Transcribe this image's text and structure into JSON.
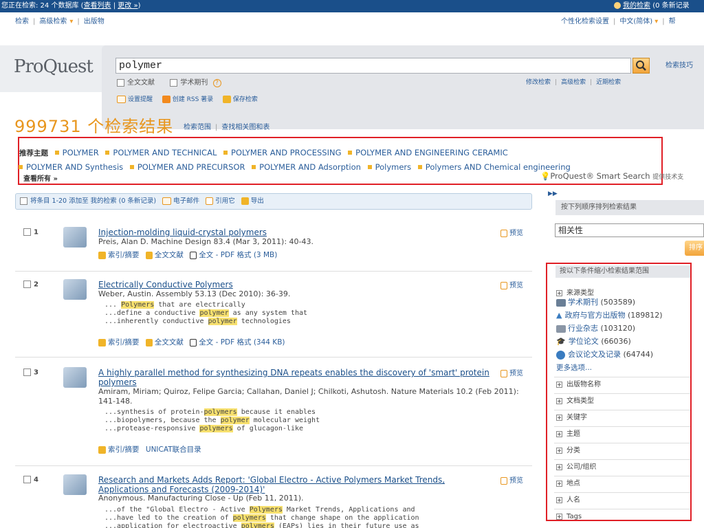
{
  "topbar": {
    "status_prefix": "您正在检索: 24 个数据库 (",
    "view_list": "查看列表",
    "sep": " | ",
    "change": "更改 »",
    "status_suffix": ")",
    "my_search": "我的检索",
    "my_search_suffix": "(0 条新记录"
  },
  "topnav": {
    "items": [
      "检索",
      "高级检索",
      "出版物"
    ],
    "right": [
      "个性化检索设置",
      "中文(简体)",
      "帮"
    ]
  },
  "logo": "ProQuest",
  "search": {
    "query": "polymer",
    "tips": "检索技巧",
    "opt_fulltext": "全文文献",
    "opt_scholarly": "学术期刊",
    "mod_links": [
      "修改检索",
      "高级检索",
      "近期检索"
    ],
    "actions": [
      "设置提醒",
      "创建 RSS 著录",
      "保存检索"
    ]
  },
  "results_header": {
    "count": "999731",
    "count_label": "个检索结果",
    "scope": "检索范围",
    "find_tables": "查找相关图和表"
  },
  "recommended": {
    "label": "推荐主题",
    "row1": [
      "POLYMER",
      "POLYMER AND TECHNICAL",
      "POLYMER AND PROCESSING",
      "POLYMER AND ENGINEERING CERAMIC"
    ],
    "row2": [
      "POLYMER AND Synthesis",
      "POLYMER AND PRECURSOR",
      "POLYMER AND Adsorption",
      "Polymers",
      "Polymers AND Chemical engineering"
    ],
    "view_all": "查看所有 »",
    "smart_search": "ProQuest® Smart Search",
    "smart_suffix": "提供技术支"
  },
  "action_row": {
    "select": "将条目 1-20 添加至 我的检索 (0 条新记录)",
    "email": "电子邮件",
    "cite": "引用它",
    "export": "导出"
  },
  "results": [
    {
      "num": "1",
      "title": "Injection-molding liquid-crystal polymers",
      "meta": "Preis, Alan D. Machine Design 83.4 (Mar 3, 2011): 40-43.",
      "snippets": [],
      "links": [
        "索引/摘要",
        "全文文献",
        "全文 - PDF 格式 (3 MB)"
      ],
      "preview": "预览"
    },
    {
      "num": "2",
      "title": "Electrically Conductive Polymers",
      "meta": "Weber, Austin. Assembly 53.13 (Dec 2010): 36-39.",
      "snippets": [
        [
          "... ",
          "Polymers",
          " that are electrically"
        ],
        [
          "...define a conductive ",
          "polymer",
          " as any system that"
        ],
        [
          "...inherently conductive ",
          "polymer",
          " technologies"
        ]
      ],
      "links": [
        "索引/摘要",
        "全文文献",
        "全文 - PDF 格式 (344 KB)"
      ],
      "preview": "预览"
    },
    {
      "num": "3",
      "title": "A highly parallel method for synthesizing DNA repeats enables the discovery of 'smart' protein polymers",
      "meta": "Amiram, Miriam; Quiroz, Felipe Garcia; Callahan, Daniel J; Chilkoti, Ashutosh. Nature Materials 10.2 (Feb 2011): 141-148.",
      "snippets": [
        [
          "...synthesis of protein-",
          "polymers",
          " because it enables"
        ],
        [
          "...biopolymers, because the ",
          "polymer",
          " molecular weight"
        ],
        [
          "...protease-responsive ",
          "polymers",
          " of glucagon-like"
        ]
      ],
      "links": [
        "索引/摘要",
        "UNICAT联合目录"
      ],
      "preview": "预览"
    },
    {
      "num": "4",
      "title": "Research and Markets Adds Report: 'Global Electro - Active Polymers Market Trends, Applications and Forecasts (2009-2014)'",
      "meta": "Anonymous. Manufacturing Close - Up (Feb 11, 2011).",
      "snippets": [
        [
          "...of the \"Global Electro - Active ",
          "Polymers",
          " Market Trends, Applications and"
        ],
        [
          "...have led to the creation of ",
          "polymers",
          " that change shape on the application"
        ],
        [
          "...application for electroactive ",
          "polymers",
          " (EAPs) lies in their future use as"
        ]
      ],
      "links": [],
      "preview": "预览"
    }
  ],
  "sidebar": {
    "sort_head": "按下列顺序排列检索结果",
    "sort_value": "相关性",
    "sort_btn": "排序",
    "narrow_head": "按以下条件缩小检索结果范围",
    "source_type": "来源类型",
    "sources": [
      {
        "label": "学术期刊",
        "count": "(503589)"
      },
      {
        "label": "政府与官方出版物",
        "count": "(189812)"
      },
      {
        "label": "行业杂志",
        "count": "(103120)"
      },
      {
        "label": "学位论文",
        "count": "(66036)"
      },
      {
        "label": "会议论文及记录",
        "count": "(64744)"
      }
    ],
    "more": "更多选项...",
    "facets": [
      "出版物名称",
      "文档类型",
      "关键字",
      "主题",
      "分类",
      "公司/组织",
      "地点",
      "人名",
      "Tags"
    ]
  }
}
